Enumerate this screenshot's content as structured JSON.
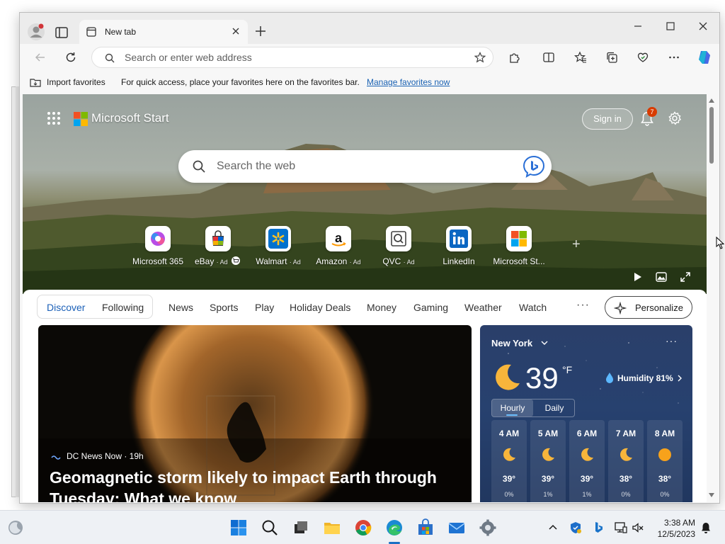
{
  "browser": {
    "tab_title": "New tab",
    "address_placeholder": "Search or enter web address",
    "favorites_bar": {
      "import_label": "Import favorites",
      "message": "For quick access, place your favorites here on the favorites bar.",
      "manage_link": "Manage favorites now"
    }
  },
  "start": {
    "brand": "Microsoft Start",
    "sign_in": "Sign in",
    "notification_count": "7",
    "search_placeholder": "Search the web",
    "quick_links": [
      {
        "label": "Microsoft 365",
        "ad": "",
        "icon": "microsoft-365-icon"
      },
      {
        "label": "eBay",
        "ad": "· Ad",
        "icon": "ebay-icon"
      },
      {
        "label": "Walmart",
        "ad": "· Ad",
        "icon": "walmart-icon"
      },
      {
        "label": "Amazon",
        "ad": "· Ad",
        "icon": "amazon-icon"
      },
      {
        "label": "QVC",
        "ad": "· Ad",
        "icon": "qvc-icon"
      },
      {
        "label": "LinkedIn",
        "ad": "",
        "icon": "linkedin-icon"
      },
      {
        "label": "Microsoft St...",
        "ad": "",
        "icon": "microsoft-store-icon"
      }
    ],
    "feed_tabs": [
      "Discover",
      "Following",
      "News",
      "Sports",
      "Play",
      "Holiday Deals",
      "Money",
      "Gaming",
      "Weather",
      "Watch"
    ],
    "more": "···",
    "personalize": "Personalize"
  },
  "news": {
    "source": "DC News Now · 19h",
    "headline": "Geomagnetic storm likely to impact Earth through Tuesday: What we know"
  },
  "weather": {
    "city": "New York",
    "temp": "39",
    "unit": "°F",
    "humidity": "Humidity 81%",
    "toggle": [
      "Hourly",
      "Daily"
    ],
    "hours": [
      {
        "time": "4 AM",
        "temp": "39°",
        "precip": "0%",
        "icon": "crescent-moon-icon"
      },
      {
        "time": "5 AM",
        "temp": "39°",
        "precip": "1%",
        "icon": "crescent-moon-icon"
      },
      {
        "time": "6 AM",
        "temp": "39°",
        "precip": "1%",
        "icon": "crescent-moon-icon"
      },
      {
        "time": "7 AM",
        "temp": "38°",
        "precip": "0%",
        "icon": "crescent-moon-icon"
      },
      {
        "time": "8 AM",
        "temp": "38°",
        "precip": "0%",
        "icon": "sun-icon"
      }
    ]
  },
  "taskbar": {
    "time": "3:38 AM",
    "date": "12/5/2023"
  },
  "colors": {
    "accent": "#1b60b8",
    "badge": "#d83b01",
    "weather_bg": "#27416f"
  }
}
